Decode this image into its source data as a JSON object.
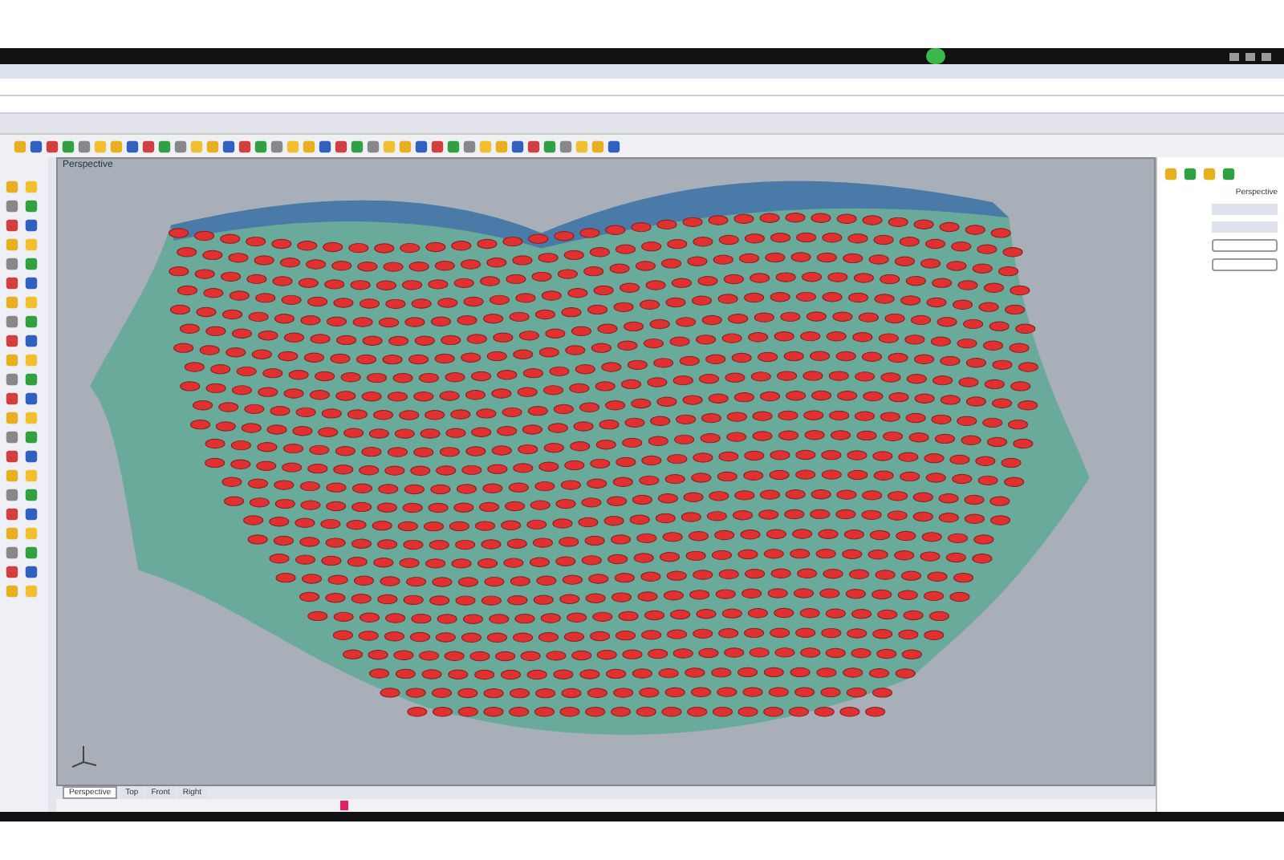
{
  "viewport": {
    "title": "Perspective"
  },
  "viewport_tabs": [
    {
      "label": "Perspective",
      "selected": true
    },
    {
      "label": "Top",
      "selected": false
    },
    {
      "label": "Front",
      "selected": false
    },
    {
      "label": "Right",
      "selected": false
    }
  ],
  "properties": {
    "view_value": "Perspective"
  }
}
